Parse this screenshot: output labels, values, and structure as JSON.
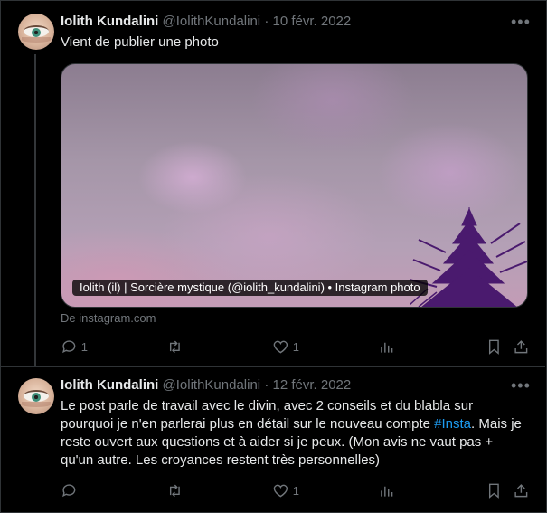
{
  "tweets": [
    {
      "author": {
        "name": "Iolith Kundalini",
        "handle": "@IolithKundalini"
      },
      "separator": "·",
      "date": "10 févr. 2022",
      "more_label": "•••",
      "text": "Vient de publier une photo",
      "card": {
        "caption": "Iolith (il) | Sorcière mystique (@iolith_kundalini) • Instagram photo",
        "source": "De instagram.com"
      },
      "actions": {
        "reply": {
          "icon": "reply-icon",
          "count": "1"
        },
        "retweet": {
          "icon": "retweet-icon",
          "count": ""
        },
        "like": {
          "icon": "heart-icon",
          "count": "1"
        },
        "views": {
          "icon": "views-icon",
          "count": ""
        },
        "bookmark": {
          "icon": "bookmark-icon"
        },
        "share": {
          "icon": "share-icon"
        }
      }
    },
    {
      "author": {
        "name": "Iolith Kundalini",
        "handle": "@IolithKundalini"
      },
      "separator": "·",
      "date": "12 févr. 2022",
      "more_label": "•••",
      "text_before": "Le post parle de travail avec le divin, avec 2 conseils et du blabla sur pourquoi je n'en parlerai plus en détail sur le nouveau compte ",
      "hashtag": "#Insta",
      "text_after": ". Mais je reste ouvert aux questions et à aider si je peux. (Mon avis ne vaut pas + qu'un autre. Les croyances restent très personnelles)",
      "actions": {
        "reply": {
          "icon": "reply-icon",
          "count": ""
        },
        "retweet": {
          "icon": "retweet-icon",
          "count": ""
        },
        "like": {
          "icon": "heart-icon",
          "count": "1"
        },
        "views": {
          "icon": "views-icon",
          "count": ""
        },
        "bookmark": {
          "icon": "bookmark-icon"
        },
        "share": {
          "icon": "share-icon"
        }
      }
    }
  ],
  "colors": {
    "background": "#000000",
    "text": "#e7e9ea",
    "muted": "#71767b",
    "link": "#1d9bf0",
    "border": "#2f3336"
  }
}
